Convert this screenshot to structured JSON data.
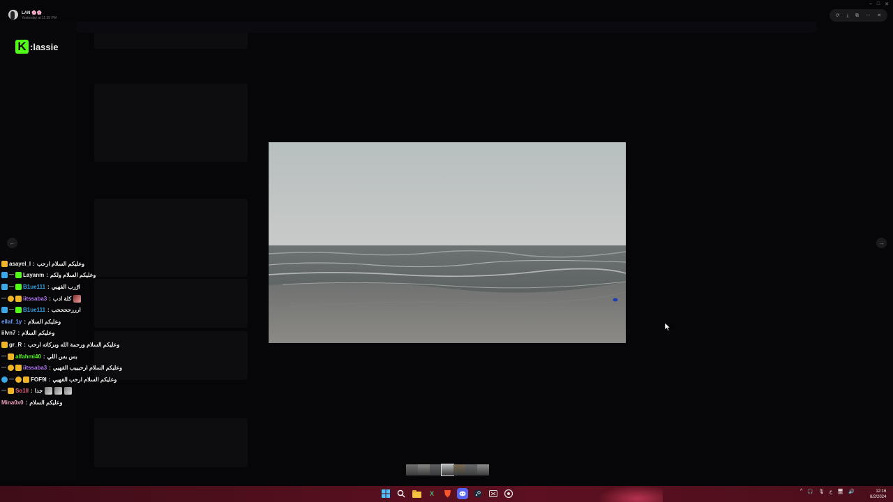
{
  "window": {
    "title": "",
    "controls": [
      "–",
      "□",
      "✕"
    ]
  },
  "user": {
    "name": "LAN 🌸🌸",
    "timestamp": "Yesterday at 11:35 PM"
  },
  "viewer_toolbar": {
    "icons": [
      "rotate-icon",
      "download-icon",
      "open-external-icon",
      "more-icon"
    ],
    "close_glyph": "✕"
  },
  "logo": {
    "mark": "K",
    "text": ":lassie",
    "brand_color": "#53fc18"
  },
  "navigation": {
    "prev_glyph": "←",
    "next_glyph": "→"
  },
  "chat": {
    "messages": [
      {
        "badges": [
          "gold"
        ],
        "user": "asayel_l",
        "user_color": "#f2f2f2",
        "message": "وعليكم السلام ارحب",
        "emotes": 0
      },
      {
        "badges": [
          "blue",
          "dash",
          "green"
        ],
        "user": "Layanm",
        "user_color": "#f2f2f2",
        "message": "وعليكم السلام ولكم",
        "emotes": 0
      },
      {
        "badges": [
          "blue",
          "dash",
          "green"
        ],
        "user": "B1ue111",
        "user_color": "#3aa8e8",
        "message": "ارّرب الفهيي",
        "emotes": 0
      },
      {
        "badges": [
          "dash",
          "gold-round",
          "gold"
        ],
        "user": "iitssaba3",
        "user_color": "#b57cf3",
        "message": "كلة ادب",
        "emotes": 1,
        "emote_color": "red"
      },
      {
        "badges": [
          "blue",
          "dash",
          "green"
        ],
        "user": "B1ue111",
        "user_color": "#3aa8e8",
        "message": "ارررححححب",
        "emotes": 0
      },
      {
        "badges": [],
        "user": "ellaf_1y",
        "user_color": "#6ea3ff",
        "message": "وعليكم السلام",
        "emotes": 0
      },
      {
        "badges": [],
        "user": "iilvn7",
        "user_color": "#f2f2f2",
        "message": "وعليكم السلام",
        "emotes": 0
      },
      {
        "badges": [
          "gold"
        ],
        "user": "gr_R",
        "user_color": "#f2f2f2",
        "message": "وعليكم السلام ورحمة الله وبركاته ارحب",
        "emotes": 0
      },
      {
        "badges": [
          "dash",
          "gold"
        ],
        "user": "alfahmi40",
        "user_color": "#53fc18",
        "message": "بس بس اللي",
        "emotes": 0
      },
      {
        "badges": [
          "dash",
          "gold-round",
          "gold"
        ],
        "user": "iitssaba3",
        "user_color": "#b57cf3",
        "message": "وعليكم السلام ارحيييب الفهيي",
        "emotes": 0
      },
      {
        "badges": [
          "blue-round",
          "dash",
          "gold-round",
          "gold"
        ],
        "user": "FOF9I",
        "user_color": "#f2f2f2",
        "message": "وعليكم السلام ارحب الفهيي",
        "emotes": 0
      },
      {
        "badges": [
          "dash",
          "gold"
        ],
        "user": "So1ll",
        "user_color": "#f06a8a",
        "message": "جدا",
        "emotes": 3,
        "emote_color": "grey"
      },
      {
        "badges": [],
        "user": "Mina0x0",
        "user_color": "#f0a3c5",
        "message": "وعليكم السلام",
        "emotes": 0
      }
    ],
    "separator": ":"
  },
  "thumbnails": {
    "count": 7,
    "active_index": 3
  },
  "taskbar": {
    "icons": [
      "windows-start-icon",
      "search-icon",
      "file-explorer-icon",
      "excel-icon",
      "brave-browser-icon",
      "discord-icon",
      "steam-icon",
      "xbox-icon",
      "chrome-icon"
    ],
    "tray": [
      "^",
      "🎧",
      "🎙",
      "ع",
      "🖥",
      "🔊",
      "🔋"
    ],
    "clock_time": "12:16",
    "clock_date": "8/2/2024",
    "accent": "#550f1d"
  }
}
